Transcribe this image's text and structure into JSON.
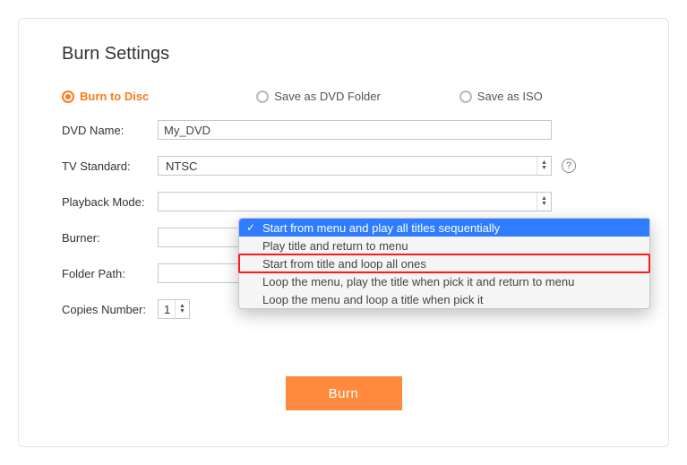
{
  "title": "Burn Settings",
  "outputOptions": {
    "burnToDisc": "Burn to Disc",
    "saveAsDVDFolder": "Save as DVD Folder",
    "saveAsISO": "Save as ISO"
  },
  "labels": {
    "dvdName": "DVD Name:",
    "tvStandard": "TV Standard:",
    "playbackMode": "Playback Mode:",
    "burner": "Burner:",
    "folderPath": "Folder Path:",
    "copiesNumber": "Copies Number:"
  },
  "values": {
    "dvdName": "My_DVD",
    "tvStandard": "NTSC",
    "copies": "1"
  },
  "playbackOptions": [
    "Start from menu and play all titles sequentially",
    "Play title and return to menu",
    "Start from title and loop all ones",
    "Loop the menu, play the title when pick it and return to menu",
    "Loop the menu and loop a title when pick it"
  ],
  "burnButton": "Burn"
}
